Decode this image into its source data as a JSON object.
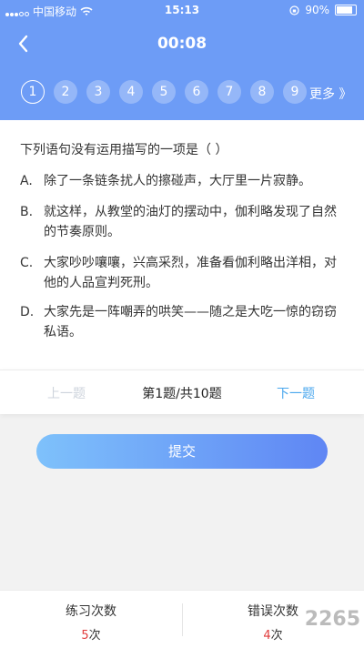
{
  "status": {
    "carrier": "中国移动",
    "time": "15:13",
    "battery": "90%"
  },
  "header": {
    "timer": "00:08",
    "numbers": [
      "1",
      "2",
      "3",
      "4",
      "5",
      "6",
      "7",
      "8",
      "9"
    ],
    "more": "更多 》"
  },
  "question": {
    "text": "下列语句没有运用描写的一项是（    ）",
    "options": [
      {
        "key": "A.",
        "text": "除了一条链条扰人的擦碰声，大厅里一片寂静。"
      },
      {
        "key": "B.",
        "text": "就这样，从教堂的油灯的摆动中，伽利略发现了自然的节奏原则。"
      },
      {
        "key": "C.",
        "text": "大家吵吵嚷嚷，兴高采烈，准备看伽利略出洋相，对他的人品宣判死刑。"
      },
      {
        "key": "D.",
        "text": "大家先是一阵嘲弄的哄笑——随之是大吃一惊的窃窃私语。"
      }
    ]
  },
  "nav": {
    "prev": "上一题",
    "counter": "第1题/共10题",
    "next": "下一题"
  },
  "submit": "提交",
  "footer": {
    "practice": {
      "label": "练习次数",
      "value": "5",
      "unit": "次"
    },
    "errors": {
      "label": "错误次数",
      "value": "4",
      "unit": "次"
    }
  },
  "watermark": "2265"
}
